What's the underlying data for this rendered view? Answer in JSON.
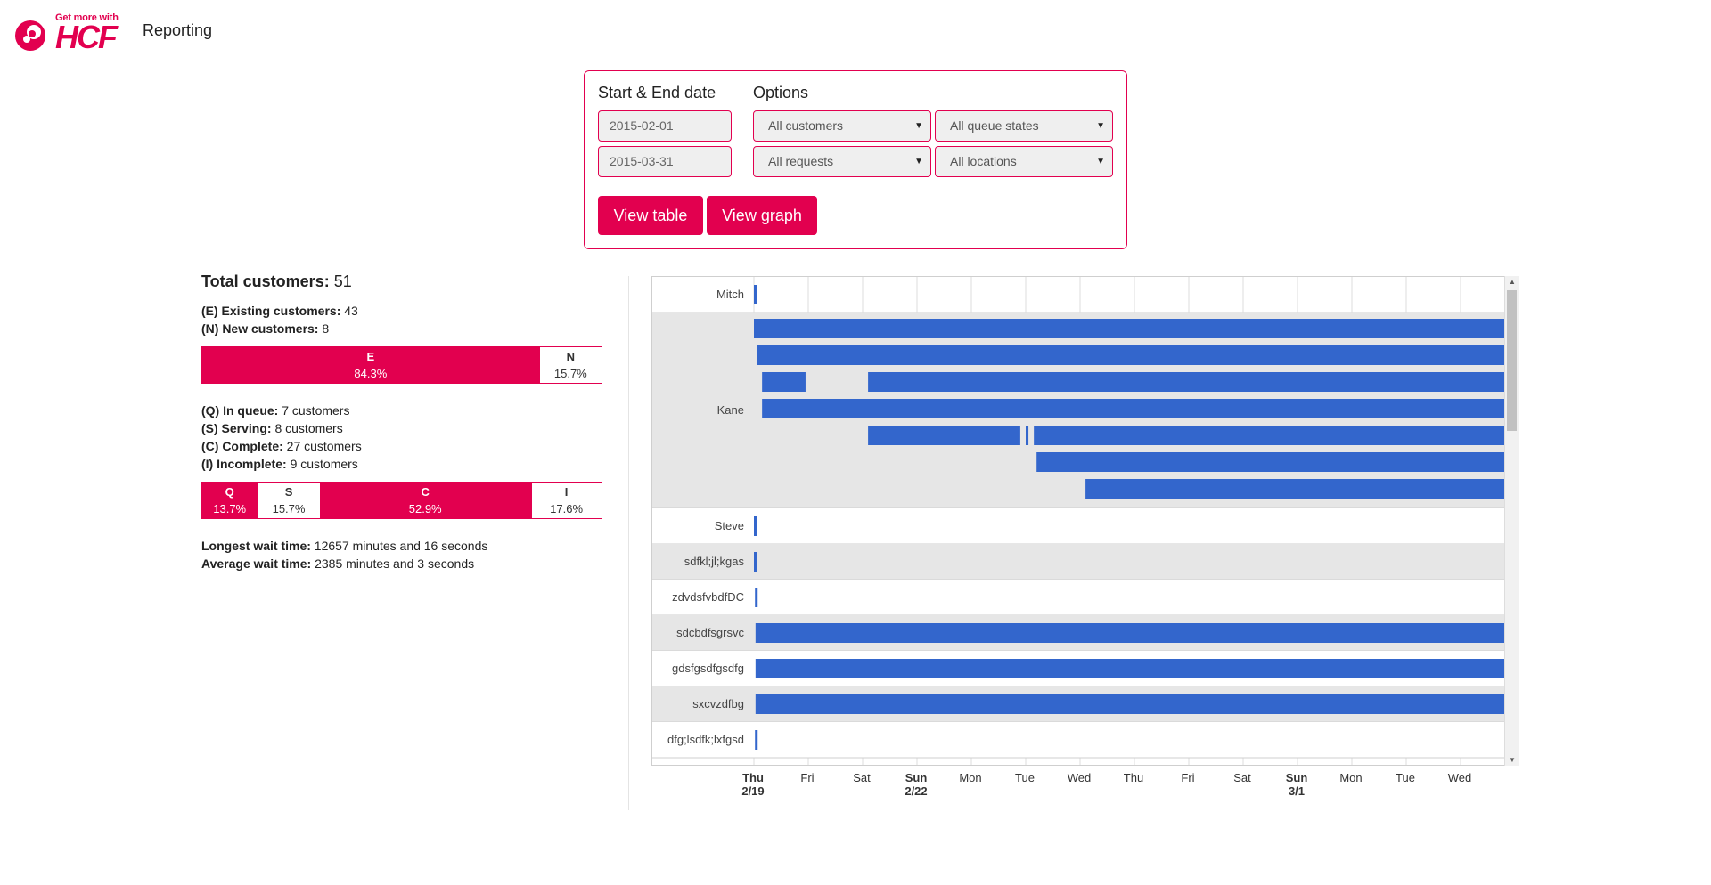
{
  "header": {
    "logo_tagline": "Get more with",
    "logo_brand": "HCF",
    "title": "Reporting"
  },
  "filters": {
    "date_label": "Start & End date",
    "options_label": "Options",
    "start_date": "2015-02-01",
    "end_date": "2015-03-31",
    "customers": "All customers",
    "queue_states": "All queue states",
    "requests": "All requests",
    "locations": "All locations",
    "view_table": "View table",
    "view_graph": "View graph"
  },
  "stats": {
    "total_label": "Total customers:",
    "total_value": "51",
    "existing_label": "(E) Existing customers:",
    "existing_value": "43",
    "new_label": "(N) New customers:",
    "new_value": "8",
    "customer_bar": [
      {
        "key": "E",
        "pct": "84.3%",
        "fraction": 0.843,
        "filled": true
      },
      {
        "key": "N",
        "pct": "15.7%",
        "fraction": 0.157,
        "filled": false
      }
    ],
    "queue_label": "(Q) In queue:",
    "queue_value": "7 customers",
    "serving_label": "(S) Serving:",
    "serving_value": "8 customers",
    "complete_label": "(C) Complete:",
    "complete_value": "27 customers",
    "incomplete_label": "(I) Incomplete:",
    "incomplete_value": "9 customers",
    "state_bar": [
      {
        "key": "Q",
        "pct": "13.7%",
        "fraction": 0.137,
        "filled": true
      },
      {
        "key": "S",
        "pct": "15.7%",
        "fraction": 0.157,
        "filled": false
      },
      {
        "key": "C",
        "pct": "52.9%",
        "fraction": 0.529,
        "filled": true
      },
      {
        "key": "I",
        "pct": "17.6%",
        "fraction": 0.176,
        "filled": false
      }
    ],
    "longest_label": "Longest wait time:",
    "longest_value": "12657 minutes and 16 seconds",
    "average_label": "Average wait time:",
    "average_value": "2385 minutes and 3 seconds"
  },
  "timeline": {
    "bar_color": "#3366cc",
    "day_labels": [
      "Thu",
      "Fri",
      "Sat",
      "Sun",
      "Mon",
      "Tue",
      "Wed",
      "Thu",
      "Fri",
      "Sat",
      "Sun",
      "Mon",
      "Tue",
      "Wed"
    ],
    "date_labels": [
      "2/19",
      "",
      "",
      "2/22",
      "",
      "",
      "",
      "",
      "",
      "",
      "3/1",
      "",
      "",
      ""
    ],
    "bold_ticks": [
      true,
      false,
      false,
      true,
      false,
      false,
      false,
      false,
      false,
      false,
      true,
      false,
      false,
      false
    ],
    "rows": [
      {
        "name": "Mitch",
        "bars": [
          [
            0.0,
            0.03
          ]
        ]
      },
      {
        "name": "Kane",
        "bars": [
          [
            0.0,
            14.1
          ],
          [
            0.05,
            14.1
          ],
          [
            0.15,
            0.95
          ],
          [
            2.1,
            14.1
          ],
          [
            0.15,
            14.1
          ],
          [
            2.1,
            4.9
          ],
          [
            5.0,
            5.05
          ],
          [
            5.15,
            14.1
          ],
          [
            5.2,
            14.1
          ],
          [
            6.1,
            14.1
          ]
        ]
      },
      {
        "name": "Steve",
        "bars": [
          [
            0.0,
            0.03
          ]
        ]
      },
      {
        "name": "sdfkl;jl;kgas",
        "bars": [
          [
            0.0,
            0.03
          ]
        ]
      },
      {
        "name": "zdvdsfvbdfDC",
        "bars": [
          [
            0.02,
            0.03
          ]
        ]
      },
      {
        "name": "sdcbdfsgrsvc",
        "bars": [
          [
            0.03,
            14.1
          ]
        ]
      },
      {
        "name": "gdsfgsdfgsdfg",
        "bars": [
          [
            0.03,
            14.1
          ]
        ]
      },
      {
        "name": "sxcvzdfbg",
        "bars": [
          [
            0.03,
            14.1
          ]
        ]
      },
      {
        "name": "dfg;lsdfk;lxfgsd",
        "bars": [
          [
            0.02,
            0.03
          ]
        ]
      }
    ]
  }
}
